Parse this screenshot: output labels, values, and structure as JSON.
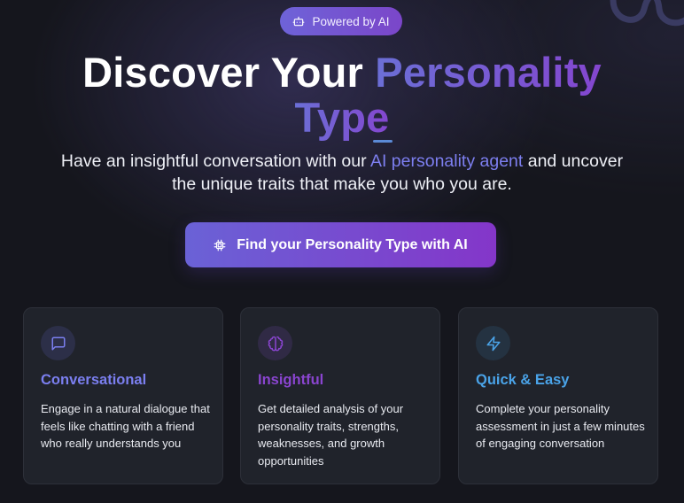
{
  "badge": {
    "label": "Powered by AI",
    "icon": "bot-icon"
  },
  "hero": {
    "title_plain": "Discover Your ",
    "title_accent_1": "Personality",
    "title_accent_2": "Type",
    "subtitle_pre": "Have an insightful conversation with our ",
    "subtitle_accent": "AI personality agent",
    "subtitle_post": " and uncover the unique traits that make you who you are."
  },
  "cta": {
    "label": "Find your Personality Type with AI",
    "icon": "chip-icon"
  },
  "features": [
    {
      "title": "Conversational",
      "description": "Engage in a natural dialogue that feels like chatting with a friend who really understands you",
      "icon": "message-square-icon",
      "color": "#7b7ff0"
    },
    {
      "title": "Insightful",
      "description": "Get detailed analysis of your personality traits, strengths, weaknesses, and growth opportunities",
      "icon": "brain-icon",
      "color": "#8a45d0"
    },
    {
      "title": "Quick & Easy",
      "description": "Complete your personality assessment in just a few minutes of engaging conversation",
      "icon": "zap-icon",
      "color": "#4aa3e8"
    }
  ]
}
